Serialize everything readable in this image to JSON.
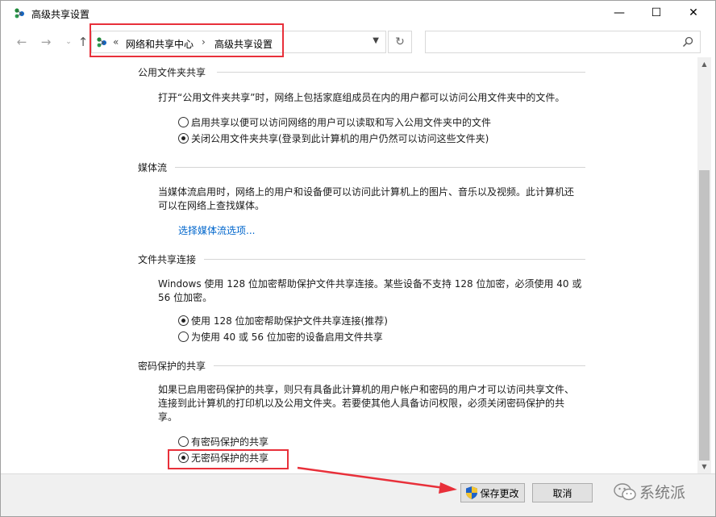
{
  "window": {
    "title": "高级共享设置",
    "controls": {
      "minimize": "—",
      "maximize": "☐",
      "close": "✕"
    }
  },
  "navbar": {
    "back": "←",
    "forward": "→",
    "recent": "⌄",
    "up": "↑",
    "address": {
      "prefix": "«",
      "crumbs": [
        "网络和共享中心",
        "高级共享设置"
      ],
      "separator": "›"
    },
    "refresh": "↻",
    "search_placeholder": ""
  },
  "sections": {
    "public_folder": {
      "header": "公用文件夹共享",
      "description": "打开“公用文件夹共享”时，网络上包括家庭组成员在内的用户都可以访问公用文件夹中的文件。",
      "options": [
        {
          "label": "启用共享以便可以访问网络的用户可以读取和写入公用文件夹中的文件",
          "checked": false
        },
        {
          "label": "关闭公用文件夹共享(登录到此计算机的用户仍然可以访问这些文件夹)",
          "checked": true
        }
      ]
    },
    "media": {
      "header": "媒体流",
      "description_line1": "当媒体流启用时，网络上的用户和设备便可以访问此计算机上的图片、音乐以及视频。此计算机还",
      "description_line2": "可以在网络上查找媒体。",
      "link": "选择媒体流选项..."
    },
    "file_sharing": {
      "header": "文件共享连接",
      "description_line1": "Windows 使用 128 位加密帮助保护文件共享连接。某些设备不支持 128 位加密，必须使用 40 或",
      "description_line2": "56 位加密。",
      "options": [
        {
          "label": "使用 128 位加密帮助保护文件共享连接(推荐)",
          "checked": true
        },
        {
          "label": "为使用 40 或 56 位加密的设备启用文件共享",
          "checked": false
        }
      ]
    },
    "password": {
      "header": "密码保护的共享",
      "description_line1": "如果已启用密码保护的共享，则只有具备此计算机的用户帐户和密码的用户才可以访问共享文件、",
      "description_line2": "连接到此计算机的打印机以及公用文件夹。若要使其他人具备访问权限，必须关闭密码保护的共",
      "description_line3": "享。",
      "options": [
        {
          "label": "有密码保护的共享",
          "checked": false
        },
        {
          "label": "无密码保护的共享",
          "checked": true
        }
      ]
    }
  },
  "footer": {
    "save_label": "保存更改",
    "cancel_label": "取消",
    "watermark": "系统派"
  },
  "colors": {
    "highlight": "#e8303a",
    "link": "#0066cc",
    "footer_bg": "#f0f0f0"
  }
}
